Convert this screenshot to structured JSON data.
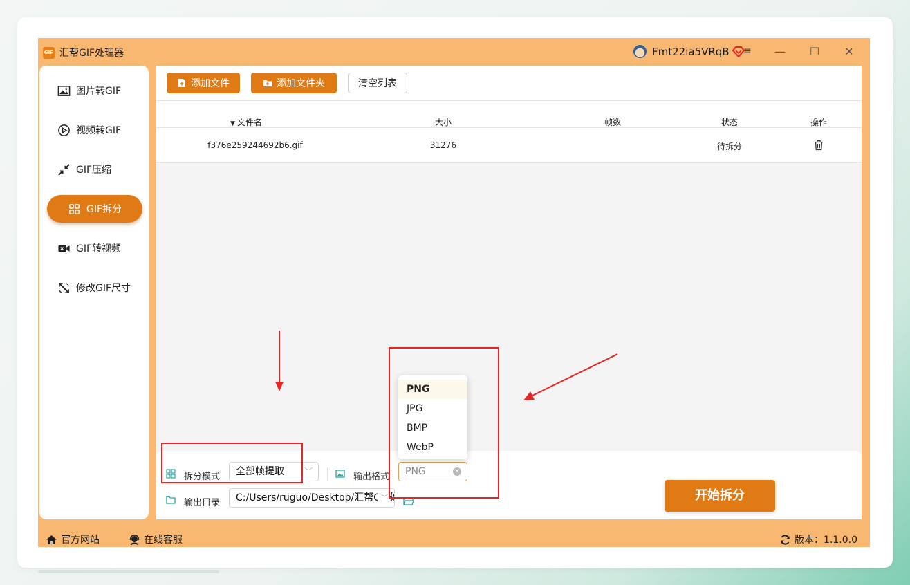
{
  "app": {
    "title": "汇帮GIF处理器",
    "logo_text": "GIF",
    "user_name": "Fmt22ia5VRqB",
    "window_controls": {
      "minimize": "—",
      "maximize": "☐",
      "close": "✕"
    }
  },
  "sidebar": {
    "items": [
      {
        "label": "图片转GIF",
        "icon": "image-icon"
      },
      {
        "label": "视频转GIF",
        "icon": "play-icon"
      },
      {
        "label": "GIF压缩",
        "icon": "compress-icon"
      },
      {
        "label": "GIF拆分",
        "icon": "split-icon",
        "active": true
      },
      {
        "label": "GIF转视频",
        "icon": "video-camera-icon"
      },
      {
        "label": "修改GIF尺寸",
        "icon": "resize-icon"
      }
    ]
  },
  "toolbar": {
    "add_file": "添加文件",
    "add_folder": "添加文件夹",
    "clear_list": "清空列表"
  },
  "table": {
    "columns": [
      "文件名",
      "大小",
      "帧数",
      "状态",
      "操作"
    ],
    "rows": [
      {
        "filename": "f376e259244692b6.gif",
        "size": "31276",
        "frames": "",
        "status": "待拆分"
      }
    ]
  },
  "options": {
    "split_mode_label": "拆分模式",
    "split_mode_value": "全部帧提取",
    "output_format_label": "输出格式",
    "output_format_value": "PNG",
    "output_dir_label": "输出目录",
    "output_dir_value": "C:/Users/ruguo/Desktop/汇帮GIF处理器"
  },
  "format_dropdown": {
    "options": [
      "PNG",
      "JPG",
      "BMP",
      "WebP"
    ],
    "selected": "PNG"
  },
  "start_button": "开始拆分",
  "footer": {
    "website": "官方网站",
    "support": "在线客服",
    "version": "版本：1.1.0.0"
  },
  "colors": {
    "accent": "#e07a14",
    "window_bg": "#f9b872",
    "annotation_red": "#e82424"
  }
}
